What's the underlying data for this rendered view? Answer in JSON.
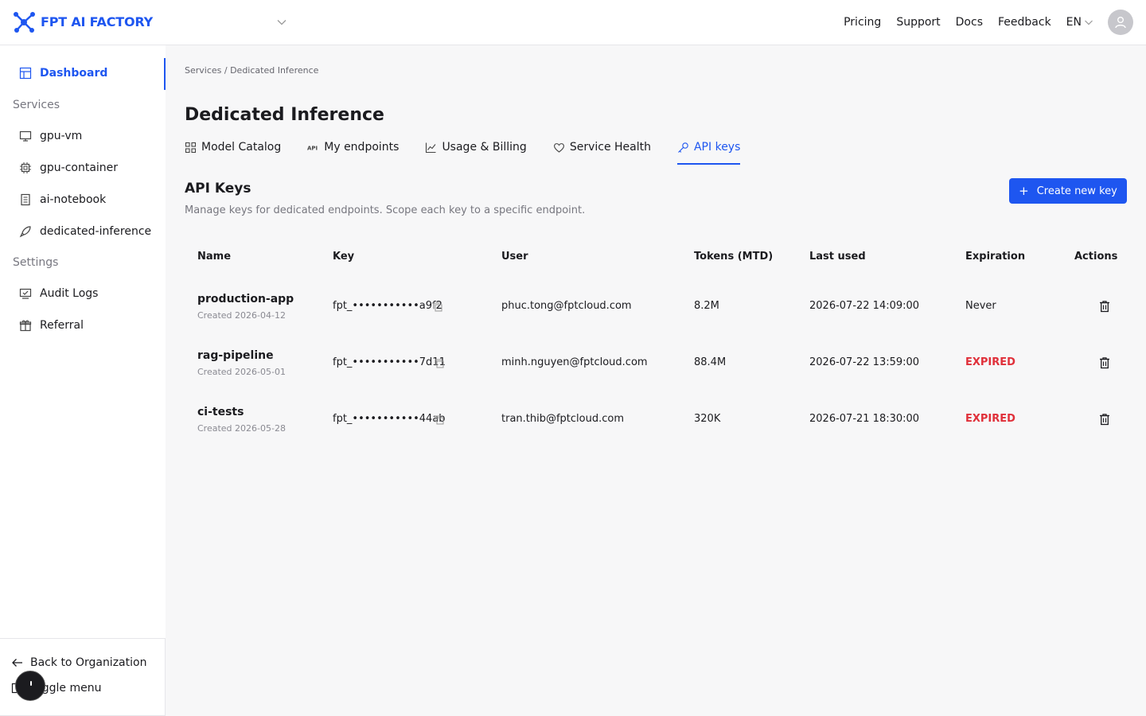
{
  "brand": {
    "name": "FPT AI FACTORY",
    "accent": "#1e56f0"
  },
  "topnav": {
    "links": [
      "Pricing",
      "Support",
      "Docs",
      "Feedback"
    ],
    "language": "EN"
  },
  "sidebar": {
    "dashboard": "Dashboard",
    "services_label": "Services",
    "services": [
      "gpu-vm",
      "gpu-container",
      "ai-notebook",
      "dedicated-inference"
    ],
    "settings_label": "Settings",
    "settings": [
      "Audit Logs",
      "Referral"
    ],
    "back_label": "Back to Organization",
    "toggle_label": "Toggle menu"
  },
  "breadcrumb": "Services / Dedicated Inference",
  "page_title": "Dedicated Inference",
  "tabs": [
    "Model Catalog",
    "My endpoints",
    "Usage & Billing",
    "Service Health",
    "API keys"
  ],
  "section": {
    "title": "API Keys",
    "description": "Manage keys for dedicated endpoints. Scope each key to a specific endpoint.",
    "create_label": "Create new key"
  },
  "table": {
    "headers": [
      "Name",
      "Key",
      "User",
      "Tokens (MTD)",
      "Last used",
      "Expiration",
      "Actions"
    ],
    "rows": [
      {
        "name": "production-app",
        "created": "Created 2026-04-12",
        "key": "fpt_•••••••••••a9f2",
        "user": "phuc.tong@fptcloud.com",
        "tokens": "8.2M",
        "last_used": "2026-07-22 14:09:00",
        "expiration": "Never",
        "expired": false
      },
      {
        "name": "rag-pipeline",
        "created": "Created 2026-05-01",
        "key": "fpt_•••••••••••7d11",
        "user": "minh.nguyen@fptcloud.com",
        "tokens": "88.4M",
        "last_used": "2026-07-22 13:59:00",
        "expiration": "EXPIRED",
        "expired": true
      },
      {
        "name": "ci-tests",
        "created": "Created 2026-05-28",
        "key": "fpt_•••••••••••44ab",
        "user": "tran.thib@fptcloud.com",
        "tokens": "320K",
        "last_used": "2026-07-21 18:30:00",
        "expiration": "EXPIRED",
        "expired": true
      }
    ]
  }
}
